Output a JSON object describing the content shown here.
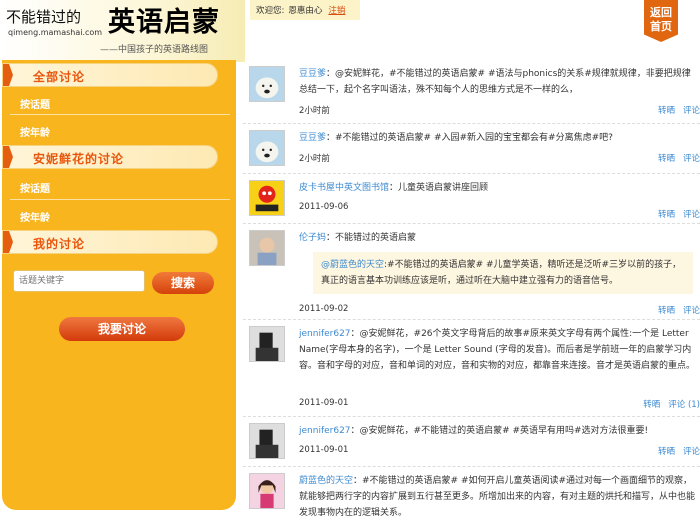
{
  "header": {
    "logo_prefix": "不能错过的",
    "logo_main": "英语启蒙",
    "logo_url": "qimeng.mamashai.com",
    "logo_sub": "——中国孩子的英语路线图",
    "welcome": "欢迎您:",
    "username": "恩惠由心",
    "logout": "注销",
    "back_home_1": "返回",
    "back_home_2": "首页"
  },
  "sidebar": {
    "section1": "全部讨论",
    "section2": "安妮鲜花的讨论",
    "section3": "我的讨论",
    "by_topic": "按话题",
    "by_age": "按年龄",
    "search_placeholder": "话题关键字",
    "search_button": "搜索",
    "discuss_button": "我要讨论"
  },
  "posts": [
    {
      "user": "豆豆爹",
      "text": "：@安妮鲜花，#不能错过的英语启蒙# #语法与phonics的关系#规律就规律，非要把规律总结一下，起个名字叫语法，殊不知每个人的思维方式是不一样的么，",
      "time": "2小时前",
      "repost": "转晒",
      "comment": "评论"
    },
    {
      "user": "豆豆爹",
      "text": "：#不能错过的英语启蒙# #入园#新入园的宝宝都会有#分离焦虑#吧?",
      "time": "2小时前",
      "repost": "转晒",
      "comment": "评论"
    },
    {
      "user": "皮卡书屋中英文图书馆",
      "text": "：儿童英语启蒙讲座回顾",
      "time": "2011-09-06",
      "repost": "转晒",
      "comment": "评论"
    },
    {
      "user": "伦子妈",
      "text": "：不能错过的英语启蒙",
      "quote_user": "@蔚蓝色的天空",
      "quote_text": ":#不能错过的英语启蒙# #儿童学英语，精听还是泛听#三岁以前的孩子，真正的语言基本功训练应该是听，通过听在大脑中建立强有力的语音信号。",
      "time": "2011-09-02",
      "repost": "转晒",
      "comment": "评论"
    },
    {
      "user": "jennifer627",
      "text": "：@安妮鲜花，#26个英文字母背后的故事#原来英文字母有两个属性:一个是 Letter Name(字母本身的名字)，一个是 Letter Sound (字母的发音)。而后者是学前班一年的启蒙学习内容。音和字母的对应，音和单词的对应，音和实物的对应，都靠音来连接。音才是英语启蒙的重点。",
      "time": "2011-09-01",
      "repost": "转晒",
      "comment": "评论 (1)"
    },
    {
      "user": "jennifer627",
      "text": "：@安妮鲜花，#不能错过的英语启蒙# #英语早有用吗#选对方法很重要!",
      "time": "2011-09-01",
      "repost": "转晒",
      "comment": "评论"
    },
    {
      "user": "蔚蓝色的天空",
      "text": "：#不能错过的英语启蒙# #如何开启儿童英语阅读#通过对每一个画面细节的观察，就能够把两行字的内容扩展到五行甚至更多。所增加出来的内容，有对主题的烘托和描写，从中也能发现事物内在的逻辑关系。"
    }
  ]
}
